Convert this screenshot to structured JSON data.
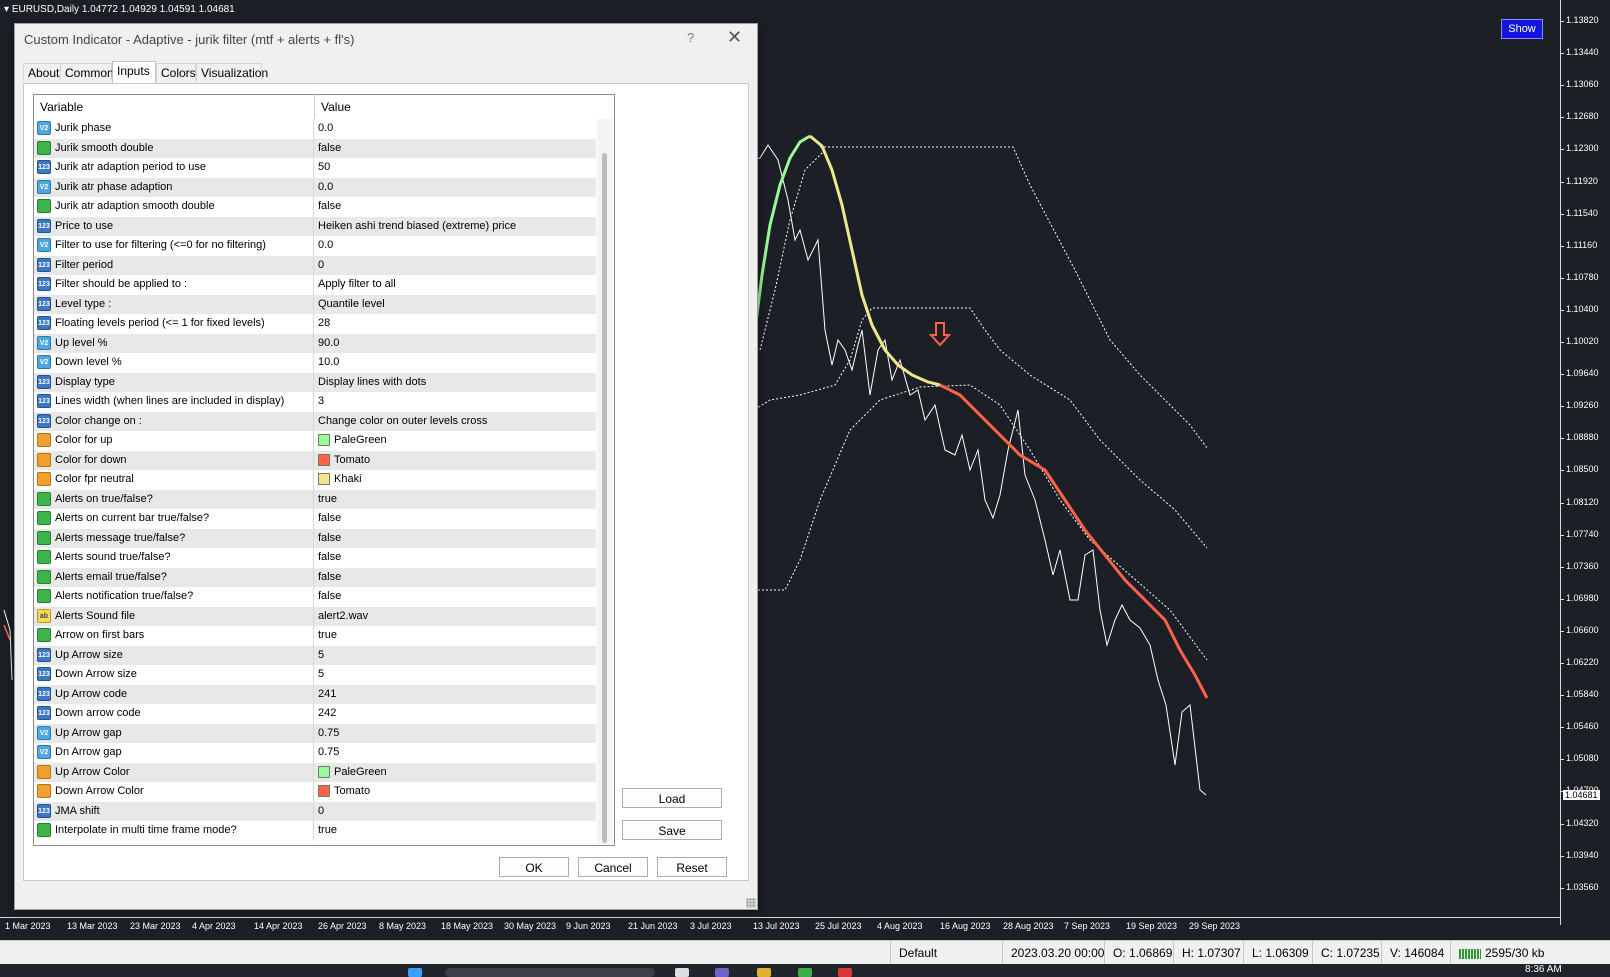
{
  "chart": {
    "symbol_line": "EURUSD,Daily  1.04772 1.04929 1.04591 1.04681",
    "show_button": "Show",
    "price_levels": [
      "1.13820",
      "1.13440",
      "1.13060",
      "1.12680",
      "1.12300",
      "1.11920",
      "1.11540",
      "1.11160",
      "1.10780",
      "1.10400",
      "1.10020",
      "1.09640",
      "1.09260",
      "1.08880",
      "1.08500",
      "1.08120",
      "1.07740",
      "1.07360",
      "1.06980",
      "1.06600",
      "1.06220",
      "1.05840",
      "1.05460",
      "1.05080",
      "1.04700",
      "1.04320",
      "1.03940",
      "1.03560"
    ],
    "current_price": "1.04681",
    "time_labels": [
      "1 Mar 2023",
      "13 Mar 2023",
      "23 Mar 2023",
      "4 Apr 2023",
      "14 Apr 2023",
      "26 Apr 2023",
      "8 May 2023",
      "18 May 2023",
      "30 May 2023",
      "9 Jun 2023",
      "21 Jun 2023",
      "3 Jul 2023",
      "13 Jul 2023",
      "25 Jul 2023",
      "4 Aug 2023",
      "16 Aug 2023",
      "28 Aug 2023",
      "7 Sep 2023",
      "19 Sep 2023",
      "29 Sep 2023"
    ],
    "colors": {
      "up": "#98fb98",
      "down": "#ff6347",
      "neutral": "#f0e68c",
      "price_line": "#ffffff",
      "levels": "#ffffff"
    }
  },
  "dialog": {
    "title": "Custom Indicator - Adaptive -  jurik filter (mtf + alerts + fl's)",
    "help": "?",
    "close": "✕",
    "tabs": [
      "About",
      "Common",
      "Inputs",
      "Colors",
      "Visualization"
    ],
    "active_tab": "Inputs",
    "columns": {
      "variable": "Variable",
      "value": "Value"
    },
    "rows": [
      {
        "type": "double",
        "icon": "double-icon",
        "variable": "Jurik phase",
        "value": "0.0"
      },
      {
        "type": "bool",
        "icon": "bool-icon",
        "variable": "Jurik smooth double",
        "value": "false"
      },
      {
        "type": "int",
        "icon": "int-icon",
        "variable": "Jurik atr adaption period to use",
        "value": "50"
      },
      {
        "type": "double",
        "icon": "double-icon",
        "variable": "Jurik atr phase adaption",
        "value": "0.0"
      },
      {
        "type": "bool",
        "icon": "bool-icon",
        "variable": "Jurik atr adaption smooth double",
        "value": "false"
      },
      {
        "type": "int",
        "icon": "int-icon",
        "variable": "Price to use",
        "value": "Heiken ashi trend biased (extreme) price"
      },
      {
        "type": "double",
        "icon": "double-icon",
        "variable": "Filter to use for filtering (<=0 for no filtering)",
        "value": "0.0"
      },
      {
        "type": "int",
        "icon": "int-icon",
        "variable": "Filter period",
        "value": "0"
      },
      {
        "type": "int",
        "icon": "int-icon",
        "variable": "Filter should be applied to :",
        "value": "Apply filter to all"
      },
      {
        "type": "int",
        "icon": "int-icon",
        "variable": "Level type :",
        "value": "Quantile level"
      },
      {
        "type": "int",
        "icon": "int-icon",
        "variable": "Floating levels period (<= 1 for fixed levels)",
        "value": "28"
      },
      {
        "type": "double",
        "icon": "double-icon",
        "variable": "Up level %",
        "value": "90.0"
      },
      {
        "type": "double",
        "icon": "double-icon",
        "variable": "Down level %",
        "value": "10.0"
      },
      {
        "type": "int",
        "icon": "int-icon",
        "variable": "Display type",
        "value": "Display lines with dots"
      },
      {
        "type": "int",
        "icon": "int-icon",
        "variable": "Lines width (when lines are included in display)",
        "value": "3"
      },
      {
        "type": "int",
        "icon": "int-icon",
        "variable": "Color change on :",
        "value": "Change color on outer levels cross"
      },
      {
        "type": "color",
        "icon": "color-icon",
        "variable": "Color for up",
        "value": "PaleGreen",
        "swatch": "#98fb98"
      },
      {
        "type": "color",
        "icon": "color-icon",
        "variable": "Color for down",
        "value": "Tomato",
        "swatch": "#ff6347"
      },
      {
        "type": "color",
        "icon": "color-icon",
        "variable": "Color fpr neutral",
        "value": "Khaki",
        "swatch": "#f0e68c"
      },
      {
        "type": "bool",
        "icon": "bool-icon",
        "variable": "Alerts on true/false?",
        "value": "true"
      },
      {
        "type": "bool",
        "icon": "bool-icon",
        "variable": "Alerts on current bar true/false?",
        "value": "false"
      },
      {
        "type": "bool",
        "icon": "bool-icon",
        "variable": "Alerts message true/false?",
        "value": "false"
      },
      {
        "type": "bool",
        "icon": "bool-icon",
        "variable": "Alerts sound true/false?",
        "value": "false"
      },
      {
        "type": "bool",
        "icon": "bool-icon",
        "variable": "Alerts email true/false?",
        "value": "false"
      },
      {
        "type": "bool",
        "icon": "bool-icon",
        "variable": "Alerts notification true/false?",
        "value": "false"
      },
      {
        "type": "str",
        "icon": "string-icon",
        "variable": "Alerts Sound file",
        "value": "alert2.wav"
      },
      {
        "type": "bool",
        "icon": "bool-icon",
        "variable": "Arrow on first bars",
        "value": "true"
      },
      {
        "type": "int",
        "icon": "int-icon",
        "variable": "Up Arrow size",
        "value": "5"
      },
      {
        "type": "int",
        "icon": "int-icon",
        "variable": "Down Arrow size",
        "value": "5"
      },
      {
        "type": "int",
        "icon": "int-icon",
        "variable": "Up Arrow code",
        "value": "241"
      },
      {
        "type": "int",
        "icon": "int-icon",
        "variable": "Down arrow code",
        "value": "242"
      },
      {
        "type": "double",
        "icon": "double-icon",
        "variable": "Up Arrow gap",
        "value": "0.75"
      },
      {
        "type": "double",
        "icon": "double-icon",
        "variable": "Dn Arrow gap",
        "value": "0.75"
      },
      {
        "type": "color",
        "icon": "color-icon",
        "variable": "Up Arrow Color",
        "value": "PaleGreen",
        "swatch": "#98fb98"
      },
      {
        "type": "color",
        "icon": "color-icon",
        "variable": "Down Arrow Color",
        "value": "Tomato",
        "swatch": "#ff6347"
      },
      {
        "type": "int",
        "icon": "int-icon",
        "variable": "JMA shift",
        "value": "0"
      },
      {
        "type": "bool",
        "icon": "bool-icon",
        "variable": "Interpolate in multi time frame mode?",
        "value": "true"
      }
    ],
    "buttons": {
      "load": "Load",
      "save": "Save",
      "ok": "OK",
      "cancel": "Cancel",
      "reset": "Reset"
    }
  },
  "status": {
    "profile": "Default",
    "datetime": "2023.03.20 00:00",
    "open": "O: 1.06869",
    "high": "H: 1.07307",
    "low": "L: 1.06309",
    "close": "C: 1.07235",
    "volume": "V: 146084",
    "traffic": "2595/30 kb"
  },
  "taskbar": {
    "time": "8:36 AM"
  }
}
